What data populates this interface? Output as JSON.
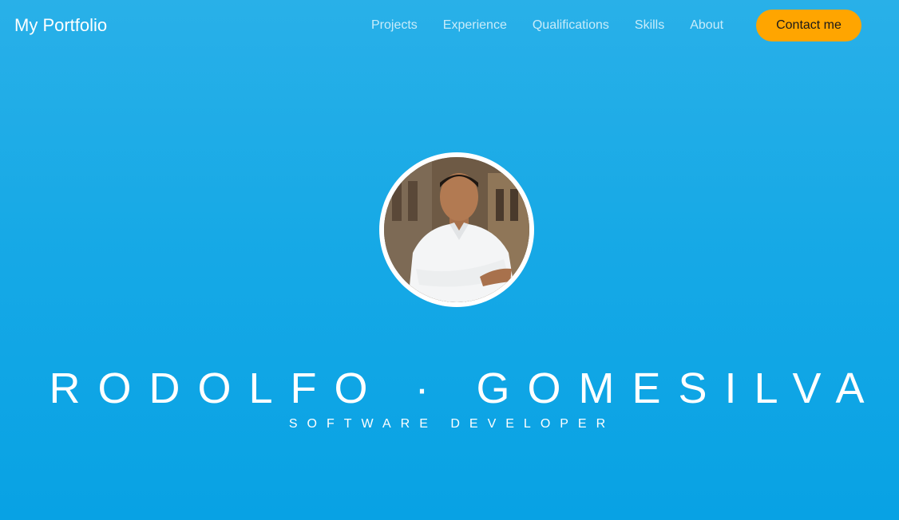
{
  "header": {
    "brand": "My Portfolio",
    "nav": [
      {
        "label": "Projects"
      },
      {
        "label": "Experience"
      },
      {
        "label": "Qualifications"
      },
      {
        "label": "Skills"
      },
      {
        "label": "About"
      }
    ],
    "contact_label": "Contact me"
  },
  "hero": {
    "name": "RODOLFO · GOMESILVA",
    "title": "SOFTWARE DEVELOPER"
  },
  "colors": {
    "background_top": "#29b0e8",
    "background_bottom": "#08a2e4",
    "accent": "#ffa500",
    "text": "#ffffff"
  }
}
